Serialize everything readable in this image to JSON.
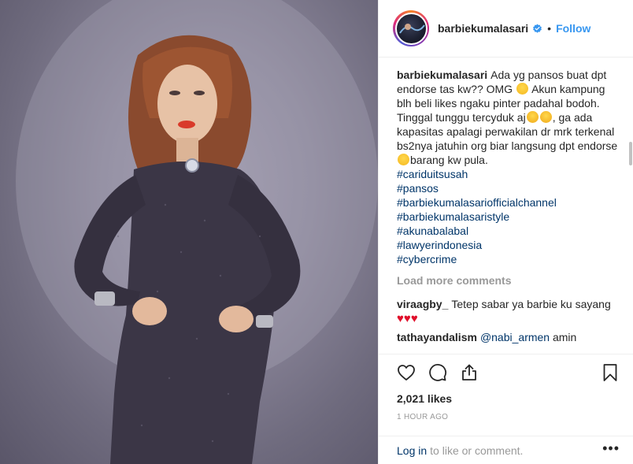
{
  "post": {
    "username": "barbiekumalasari",
    "follow_label": "Follow",
    "separator": "•"
  },
  "caption": {
    "username": "barbiekumalasari",
    "text_1": "Ada yg pansos buat dpt endorse tas kw?? OMG",
    "text_2": "Akun kampung blh beli likes ngaku pinter padahal bodoh. Tinggal tunggu tercyduk aj",
    "text_3": ", ga ada kapasitas apalagi perwakilan dr mrk terkenal bs2nya jatuhin org biar langsung dpt endorse",
    "text_4": "barang kw pula.",
    "hashtags": [
      "#cariduitsusah",
      "#pansos",
      "#barbiekumalasariofficialchannel",
      "#barbiekumalasaristyle",
      "#akunabalabal",
      "#lawyerindonesia",
      "#cybercrime"
    ]
  },
  "load_more_label": "Load more comments",
  "comments": [
    {
      "username": "viraagby_",
      "text": "Tetep sabar ya barbie ku sayang",
      "hearts": "♥♥♥"
    },
    {
      "username": "tathayandalism",
      "mention": "@nabi_armen",
      "text": "amin"
    }
  ],
  "likes_label": "2,021 likes",
  "time_label": "1 HOUR AGO",
  "footer": {
    "login_label": "Log in",
    "rest_label": "to like or comment.",
    "more_label": "•••"
  },
  "icons": {
    "verified": "verified-badge-icon",
    "like": "heart-icon",
    "comment": "comment-bubble-icon",
    "share": "share-icon",
    "save": "bookmark-icon",
    "more": "more-options-icon"
  },
  "colors": {
    "link": "#3897f0",
    "hashtag": "#003569",
    "muted": "#999999",
    "text": "#262626"
  }
}
